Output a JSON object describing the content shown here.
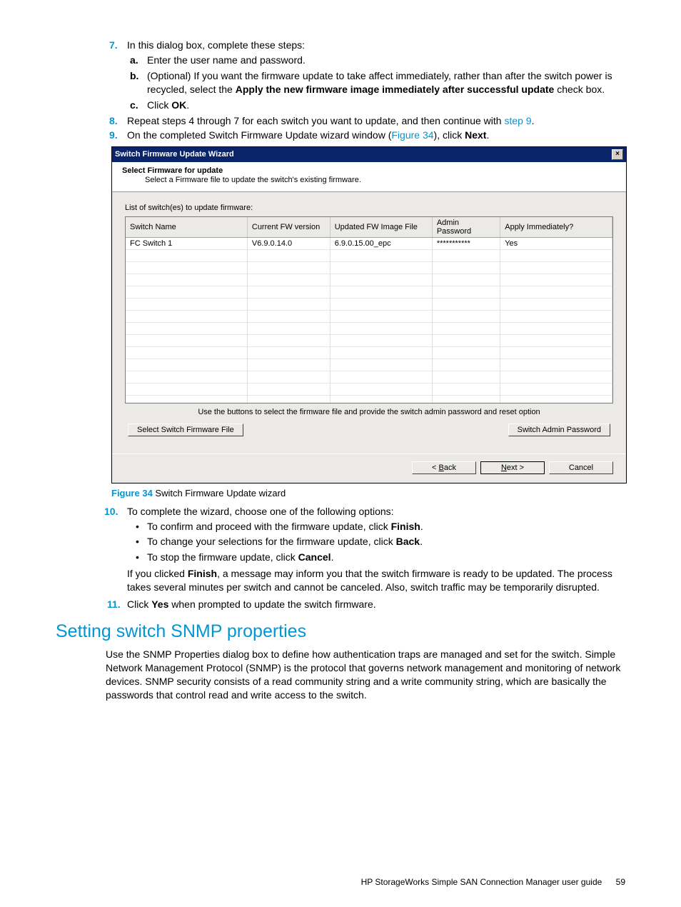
{
  "steps": {
    "s7": {
      "num": "7.",
      "text": "In this dialog box, complete these steps:",
      "a_letter": "a.",
      "a_text": "Enter the user name and password.",
      "b_letter": "b.",
      "b_pre": "(Optional) If you want the firmware update to take affect immediately, rather than after the switch power is recycled, select the ",
      "b_bold": "Apply the new firmware image immediately after successful update",
      "b_post": " check box.",
      "c_letter": "c.",
      "c_pre": "Click ",
      "c_bold": "OK",
      "c_post": "."
    },
    "s8": {
      "num": "8.",
      "pre": "Repeat steps 4 through 7 for each switch you want to update, and then continue with ",
      "link": "step 9",
      "post": "."
    },
    "s9": {
      "num": "9.",
      "pre": "On the completed Switch Firmware Update wizard window (",
      "link": "Figure 34",
      "mid": "), click ",
      "bold": "Next",
      "post": "."
    },
    "s10": {
      "num": "10.",
      "text": "To complete the wizard, choose one of the following options:",
      "b1_pre": "To confirm and proceed with the firmware update, click ",
      "b1_bold": "Finish",
      "b1_post": ".",
      "b2_pre": "To change your selections for the firmware update, click ",
      "b2_bold": "Back",
      "b2_post": ".",
      "b3_pre": "To stop the firmware update, click ",
      "b3_bold": "Cancel",
      "b3_post": ".",
      "after_pre": "If you clicked ",
      "after_bold": "Finish",
      "after_post": ", a message may inform you that the switch firmware is ready to be updated. The process takes several minutes per switch and cannot be canceled. Also, switch traffic may be temporarily disrupted."
    },
    "s11": {
      "num": "11.",
      "pre": "Click ",
      "bold": "Yes",
      "post": " when prompted to update the switch firmware."
    }
  },
  "wizard": {
    "title": "Switch Firmware Update Wizard",
    "close": "×",
    "head1": "Select Firmware for update",
    "head2": "Select a Firmware file to update the switch's existing firmware.",
    "list_label": "List of switch(es) to update firmware:",
    "cols": [
      "Switch Name",
      "Current FW version",
      "Updated FW Image File",
      "Admin Password",
      "Apply Immediately?"
    ],
    "row": [
      "FC Switch 1",
      "V6.9.0.14.0",
      "6.9.0.15.00_epc",
      "***********",
      "Yes"
    ],
    "hint": "Use the buttons to select the firmware file and provide the switch admin password and reset option",
    "btn_select": "Select Switch Firmware File",
    "btn_admin": "Switch Admin Password",
    "btn_back_pre": "< ",
    "btn_back_u": "B",
    "btn_back_post": "ack",
    "btn_next_u": "N",
    "btn_next_post": "ext >",
    "btn_cancel": "Cancel"
  },
  "figure": {
    "num": "Figure 34",
    "text": " Switch Firmware Update wizard"
  },
  "section_heading": "Setting switch SNMP properties",
  "section_para": "Use the SNMP Properties dialog box to define how authentication traps are managed and set for the switch. Simple Network Management Protocol (SNMP) is the protocol that governs network management and monitoring of network devices. SNMP security consists of a read community string and a write community string, which are basically the passwords that control read and write access to the switch.",
  "footer": {
    "text": "HP StorageWorks Simple SAN Connection Manager user guide",
    "page": "59"
  }
}
